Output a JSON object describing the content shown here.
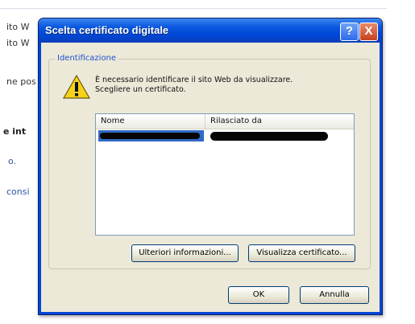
{
  "background_page": {
    "fragments": [
      "ito W",
      "ito W",
      "ne pos",
      "e int",
      "o.",
      "consi"
    ]
  },
  "dialog": {
    "title": "Scelta certificato digitale",
    "help_glyph": "?",
    "close_glyph": "X",
    "group_label": "Identificazione",
    "icon": "warning-icon",
    "message_line1": "È necessario identificare il sito Web da visualizzare.",
    "message_line2": "Scegliere un certificato.",
    "table": {
      "columns": [
        "Nome",
        "Rilasciato da"
      ],
      "rows": [
        {
          "name": "",
          "issuer": "",
          "redacted": true,
          "selected": true
        }
      ]
    },
    "buttons": {
      "more_info": "Ulteriori informazioni...",
      "view_certificate": "Visualizza certificato...",
      "ok": "OK",
      "cancel": "Annulla"
    }
  },
  "colors": {
    "titlebar": "#0046d6",
    "dialog_bg": "#ece9d8",
    "selection": "#316ac5",
    "group_label": "#1e4fd0"
  }
}
